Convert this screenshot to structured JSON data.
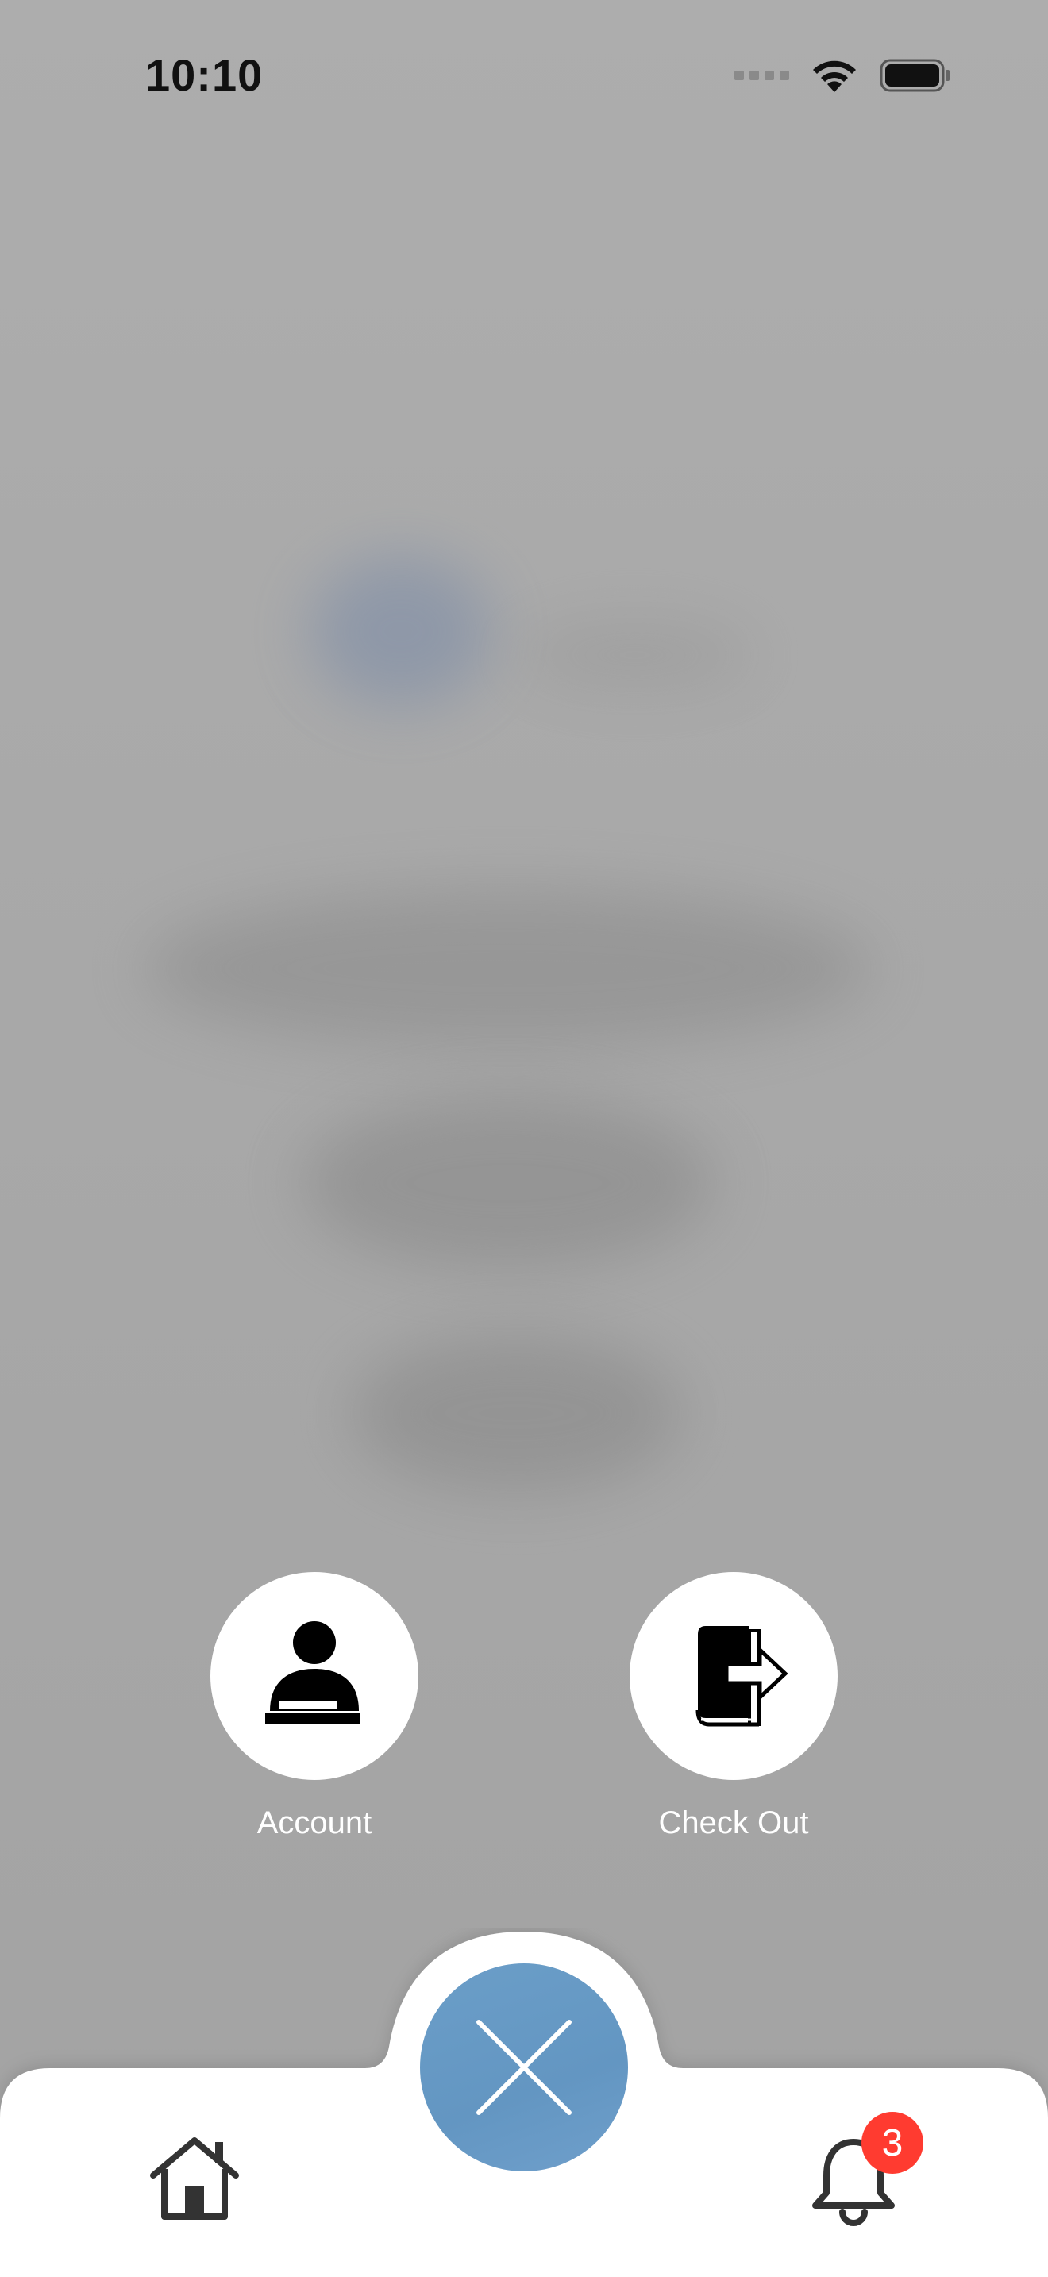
{
  "status_bar": {
    "time": "10:10",
    "icons": [
      "signal-icon",
      "wifi-icon",
      "battery-icon"
    ]
  },
  "actions": [
    {
      "label": "Account",
      "icon": "account-icon"
    },
    {
      "label": "Check Out",
      "icon": "checkout-book-icon"
    }
  ],
  "tab_bar": {
    "items": [
      {
        "name": "home",
        "icon": "home-icon"
      },
      {
        "name": "close",
        "icon": "close-icon"
      },
      {
        "name": "notifications",
        "icon": "bell-icon",
        "badge": "3"
      }
    ]
  },
  "colors": {
    "overlay": "#a7a7a7",
    "fab": "#6699c4",
    "badge": "#ff3b30",
    "tab_bar": "#ffffff"
  }
}
